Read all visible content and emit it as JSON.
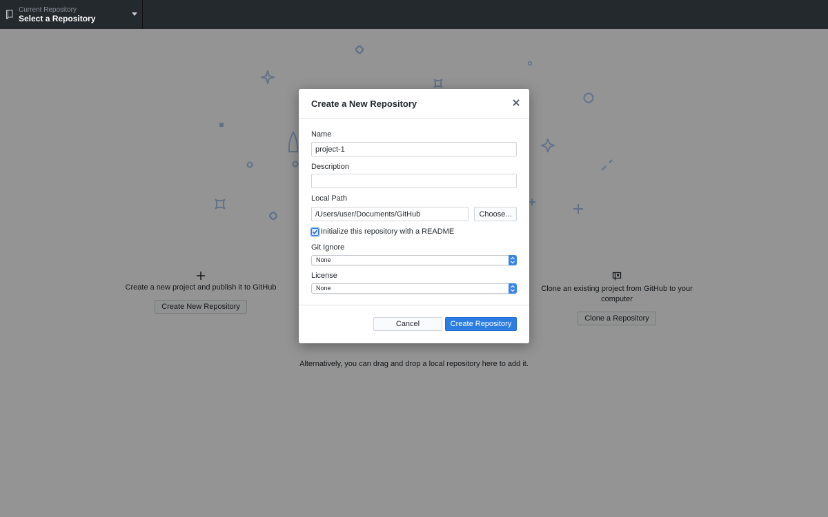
{
  "toolbar": {
    "repo_label": "Current Repository",
    "repo_value": "Select a Repository",
    "repo_icon": "repo-icon",
    "caret_icon": "chevron-down-icon"
  },
  "blank_slate": {
    "create": {
      "icon": "plus-icon",
      "text": "Create a new project and publish it to GitHub",
      "button": "Create New Repository"
    },
    "clone": {
      "icon": "repo-clone-icon",
      "text_line1": "Clone an existing project from GitHub to your",
      "text_line2": "computer",
      "button": "Clone a Repository"
    },
    "alt_text": "Alternatively, you can drag and drop a local repository here to add it."
  },
  "dialog": {
    "title": "Create a New Repository",
    "close_icon": "close-icon",
    "name_label": "Name",
    "name_value": "project-1",
    "description_label": "Description",
    "description_value": "",
    "local_path_label": "Local Path",
    "local_path_value": "/Users/user/Documents/GitHub",
    "choose_button": "Choose...",
    "readme_label": "Initialize this repository with a README",
    "readme_checked": true,
    "gitignore_label": "Git Ignore",
    "gitignore_value": "None",
    "license_label": "License",
    "license_value": "None",
    "cancel_button": "Cancel",
    "create_button": "Create Repository"
  },
  "colors": {
    "toolbar_bg": "#24292e",
    "primary_button": "#2b7de1",
    "decoration": "#a8c4ea"
  }
}
